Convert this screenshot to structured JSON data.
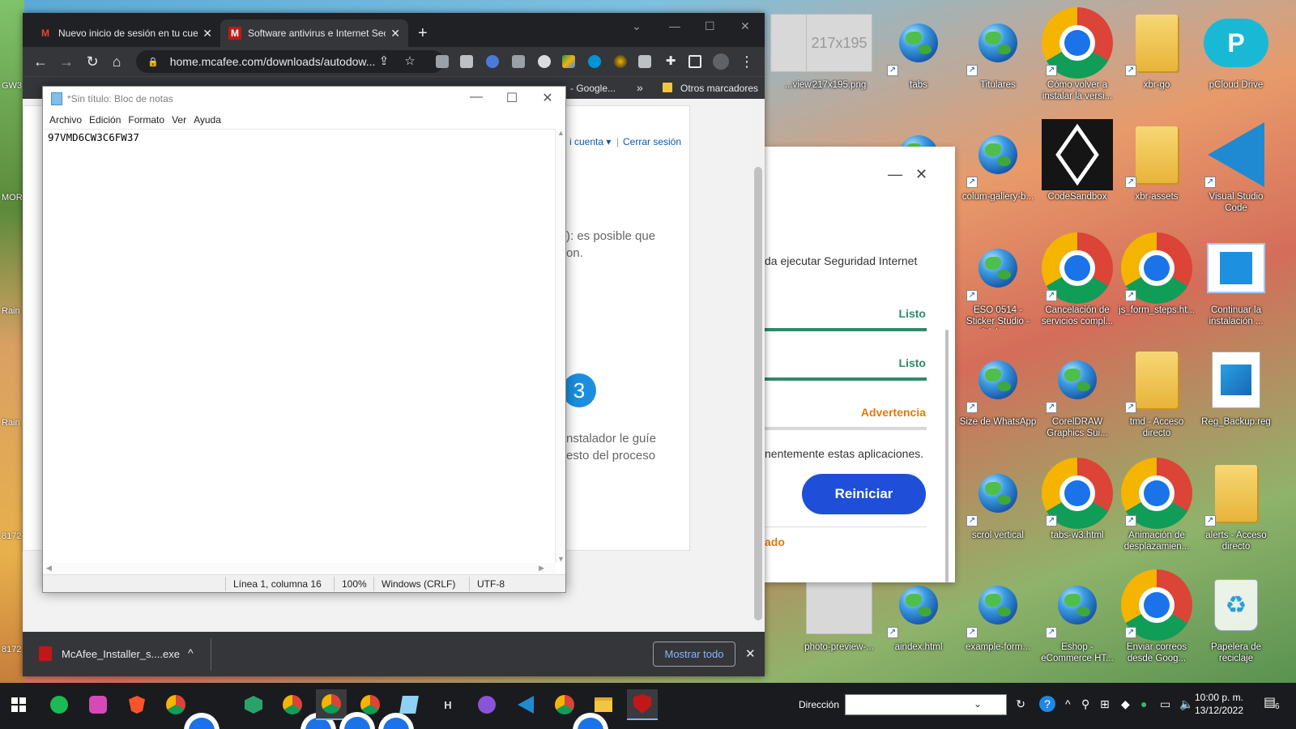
{
  "desktop": {
    "left_labels": [
      "GW3",
      "MOR",
      "Rain",
      "Rain",
      "8172",
      "8172"
    ],
    "icons": [
      {
        "label": "...view-...",
        "kind": "image"
      },
      {
        "label": "217x195.png",
        "kind": "image",
        "thumb_text": "217x195"
      },
      {
        "label": "tabs",
        "kind": "globe"
      },
      {
        "label": "Titulares",
        "kind": "globe"
      },
      {
        "label": "Cómo volver a instalar la versi...",
        "kind": "chrome"
      },
      {
        "label": "xbr-go",
        "kind": "folder"
      },
      {
        "label": "pCloud Drive",
        "kind": "pcloud"
      },
      {
        "label": "",
        "kind": "globe"
      },
      {
        "label": "colum-gallery-b...",
        "kind": "globe"
      },
      {
        "label": "CodeSandbox",
        "kind": "codesandbox"
      },
      {
        "label": "xbr-assets",
        "kind": "folder"
      },
      {
        "label": "Visual Studio Code",
        "kind": "vscode"
      },
      {
        "label": "ESO 0514 - Sticker Studio - Sticker...",
        "kind": "globe"
      },
      {
        "label": "Cancelación de servicios compl...",
        "kind": "chrome"
      },
      {
        "label": "js_form_steps.ht...",
        "kind": "chrome"
      },
      {
        "label": "Continuar la instalación ...",
        "kind": "window"
      },
      {
        "label": "Size de WhatsApp",
        "kind": "globe"
      },
      {
        "label": "CorelDRAW Graphics Sui...",
        "kind": "globe"
      },
      {
        "label": "tmd - Acceso directo",
        "kind": "folder"
      },
      {
        "label": "Reg_Backup.reg",
        "kind": "reg"
      },
      {
        "label": "scrol vertical",
        "kind": "globe"
      },
      {
        "label": "tabs-w3.html",
        "kind": "chrome"
      },
      {
        "label": "Animación de desplazamien...",
        "kind": "chrome"
      },
      {
        "label": "alerts - Acceso directo",
        "kind": "folder"
      },
      {
        "label": "photo-preview-...",
        "kind": "image"
      },
      {
        "label": "aindex.html",
        "kind": "globe"
      },
      {
        "label": "example-form...",
        "kind": "globe"
      },
      {
        "label": "Eshop - eCommerce HT...",
        "kind": "globe"
      },
      {
        "label": "Enviar correos desde Goog...",
        "kind": "chrome"
      },
      {
        "label": "Papelera de reciclaje",
        "kind": "recycle"
      }
    ]
  },
  "browser": {
    "tabs": [
      {
        "label": "Nuevo inicio de sesión en tu cue",
        "favicon": "M",
        "color": "#ea4335"
      },
      {
        "label": "Software antivirus e Internet Secu",
        "favicon": "M",
        "color": "#c01818",
        "active": true
      }
    ],
    "url": "home.mcafee.com/downloads/autodow...",
    "bookmarks_right": "- Google...",
    "bookmarks_more": "»",
    "other_bookmarks": "Otros marcadores",
    "page": {
      "account_link": "i cuenta ▾",
      "separator": "|",
      "logout_link": "Cerrar sesión",
      "text1_line1": "): es posible que",
      "text1_line2": "on.",
      "step_number": "3",
      "text2_line1": "nstalador le guíe",
      "text2_line2": "esto del proceso"
    },
    "download": {
      "filename": "McAfee_Installer_s....exe",
      "show_all": "Mostrar todo",
      "chevron": "^",
      "close": "✕"
    }
  },
  "mcafee_panel": {
    "minimize": "—",
    "close": "✕",
    "description": "da ejecutar Seguridad Internet",
    "steps": [
      {
        "status": "Listo",
        "color": "#2e8b6a"
      },
      {
        "status": "Listo",
        "color": "#2e8b6a"
      },
      {
        "status": "Advertencia",
        "color": "#e07a10"
      }
    ],
    "note": "nentemente estas aplicaciones.",
    "restart_button": "Reiniciar",
    "footer_link": "ado"
  },
  "notepad": {
    "title": "*Sin título: Bloc de notas",
    "menu": [
      "Archivo",
      "Edición",
      "Formato",
      "Ver",
      "Ayuda"
    ],
    "content": "97VMD6CW3C6FW37",
    "status": {
      "position": "Línea 1, columna 16",
      "zoom": "100%",
      "line_endings": "Windows (CRLF)",
      "encoding": "UTF-8"
    }
  },
  "taskbar": {
    "address_label": "Dirección",
    "time": "10:00 p. m.",
    "date": "13/12/2022",
    "notification_count": "6",
    "apps": [
      "start",
      "spotify",
      "app-purple",
      "brave",
      "chrome-user",
      "app-green",
      "chrome",
      "chrome-active",
      "chrome-2",
      "notepad",
      "h-app",
      "github",
      "vscode",
      "chrome-3",
      "file-explorer",
      "mcafee"
    ]
  }
}
